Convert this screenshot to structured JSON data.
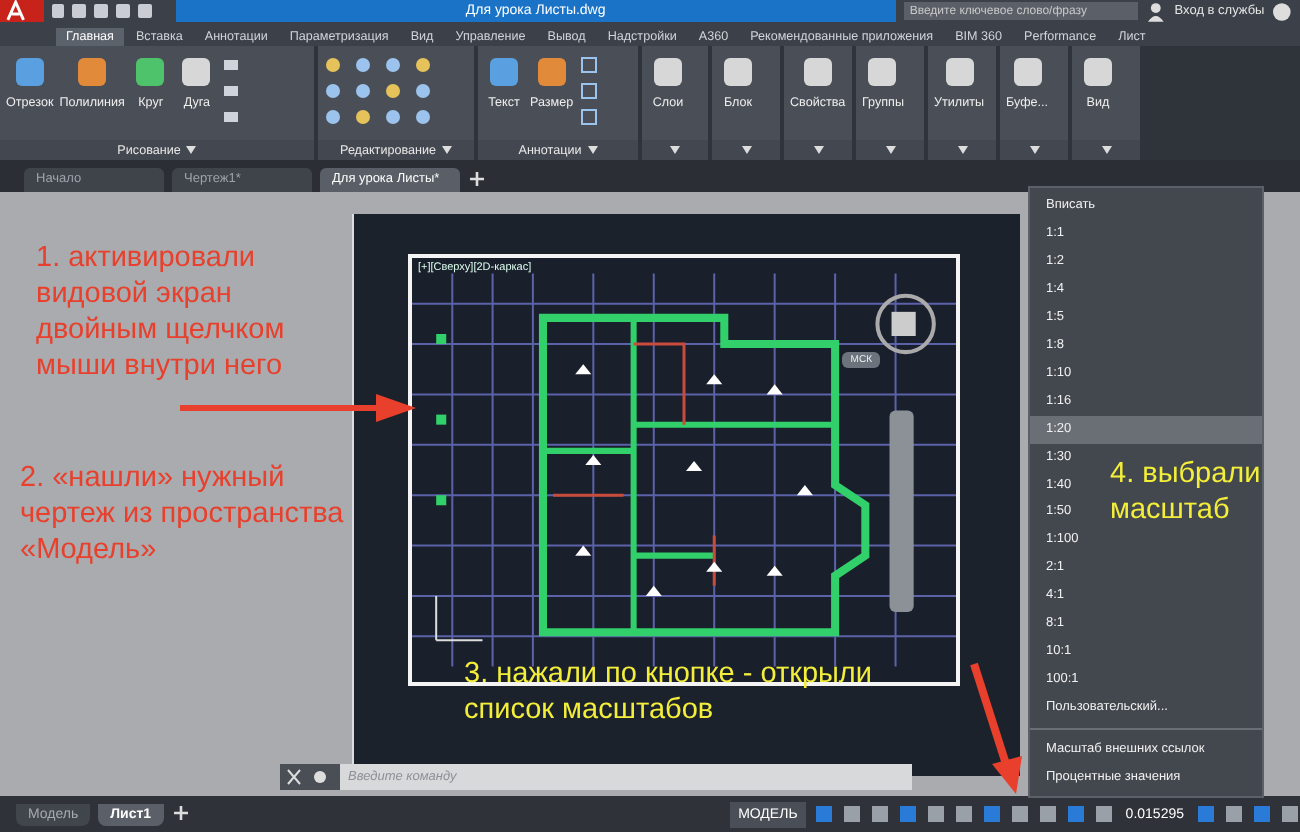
{
  "title_bar": {
    "document_title": "Для урока Листы.dwg",
    "search_placeholder": "Введите ключевое слово/фразу",
    "sign_in": "Вход в службы"
  },
  "ribbon_tabs": [
    {
      "label": "Главная",
      "selected": true
    },
    {
      "label": "Вставка",
      "selected": false
    },
    {
      "label": "Аннотации",
      "selected": false
    },
    {
      "label": "Параметризация",
      "selected": false
    },
    {
      "label": "Вид",
      "selected": false
    },
    {
      "label": "Управление",
      "selected": false
    },
    {
      "label": "Вывод",
      "selected": false
    },
    {
      "label": "Надстройки",
      "selected": false
    },
    {
      "label": "A360",
      "selected": false
    },
    {
      "label": "Рекомендованные приложения",
      "selected": false
    },
    {
      "label": "BIM 360",
      "selected": false
    },
    {
      "label": "Performance",
      "selected": false
    },
    {
      "label": "Лист",
      "selected": false
    }
  ],
  "ribbon_panels": [
    {
      "kind": "draw",
      "title": "Рисование",
      "tools": [
        "Отрезок",
        "Полилиния",
        "Круг",
        "Дуга"
      ]
    },
    {
      "kind": "modify",
      "title": "Редактирование"
    },
    {
      "kind": "annotate",
      "title": "Аннотации",
      "tools": [
        "Текст",
        "Размер"
      ]
    },
    {
      "kind": "single",
      "tools": [
        "Слои"
      ]
    },
    {
      "kind": "single",
      "tools": [
        "Блок"
      ]
    },
    {
      "kind": "single",
      "tools": [
        "Свойства"
      ]
    },
    {
      "kind": "single",
      "tools": [
        "Группы"
      ]
    },
    {
      "kind": "single",
      "tools": [
        "Утилиты"
      ]
    },
    {
      "kind": "single",
      "tools": [
        "Буфе..."
      ]
    },
    {
      "kind": "single",
      "tools": [
        "Вид"
      ]
    }
  ],
  "document_tabs": [
    {
      "label": "Начало",
      "selected": false
    },
    {
      "label": "Чертеж1*",
      "selected": false
    },
    {
      "label": "Для урока Листы*",
      "selected": true
    }
  ],
  "viewport": {
    "label": "[+][Сверху][2D-каркас]",
    "ucs_label": "МСК"
  },
  "command_line": {
    "placeholder": "Введите команду"
  },
  "layout_tabs": [
    {
      "label": "Модель",
      "selected": false
    },
    {
      "label": "Лист1",
      "selected": true
    }
  ],
  "status_bar": {
    "mode": "МОДЕЛЬ",
    "scale": "0.015295"
  },
  "scale_menu": {
    "items": [
      {
        "label": "Вписать",
        "selected": false
      },
      {
        "label": "1:1",
        "selected": false
      },
      {
        "label": "1:2",
        "selected": false
      },
      {
        "label": "1:4",
        "selected": false
      },
      {
        "label": "1:5",
        "selected": false
      },
      {
        "label": "1:8",
        "selected": false
      },
      {
        "label": "1:10",
        "selected": false
      },
      {
        "label": "1:16",
        "selected": false
      },
      {
        "label": "1:20",
        "selected": true
      },
      {
        "label": "1:30",
        "selected": false
      },
      {
        "label": "1:40",
        "selected": false
      },
      {
        "label": "1:50",
        "selected": false
      },
      {
        "label": "1:100",
        "selected": false
      },
      {
        "label": "2:1",
        "selected": false
      },
      {
        "label": "4:1",
        "selected": false
      },
      {
        "label": "8:1",
        "selected": false
      },
      {
        "label": "10:1",
        "selected": false
      },
      {
        "label": "100:1",
        "selected": false
      },
      {
        "label": "Пользовательский...",
        "selected": false
      }
    ],
    "footer_items": [
      "Масштаб внешних ссылок",
      "Процентные значения"
    ]
  },
  "annotations": [
    {
      "text": "1. активировали видовой экран двойным щелчком мыши внутри него",
      "color": "#e8402c"
    },
    {
      "text": "2. «нашли» нужный чертеж из пространства «Модель»",
      "color": "#e8402c"
    },
    {
      "text": "3. нажали по кнопке - открыли список масштабов",
      "color": "#f2ee3a"
    },
    {
      "text": "4. выбрали масштаб",
      "color": "#f2ee3a"
    }
  ]
}
